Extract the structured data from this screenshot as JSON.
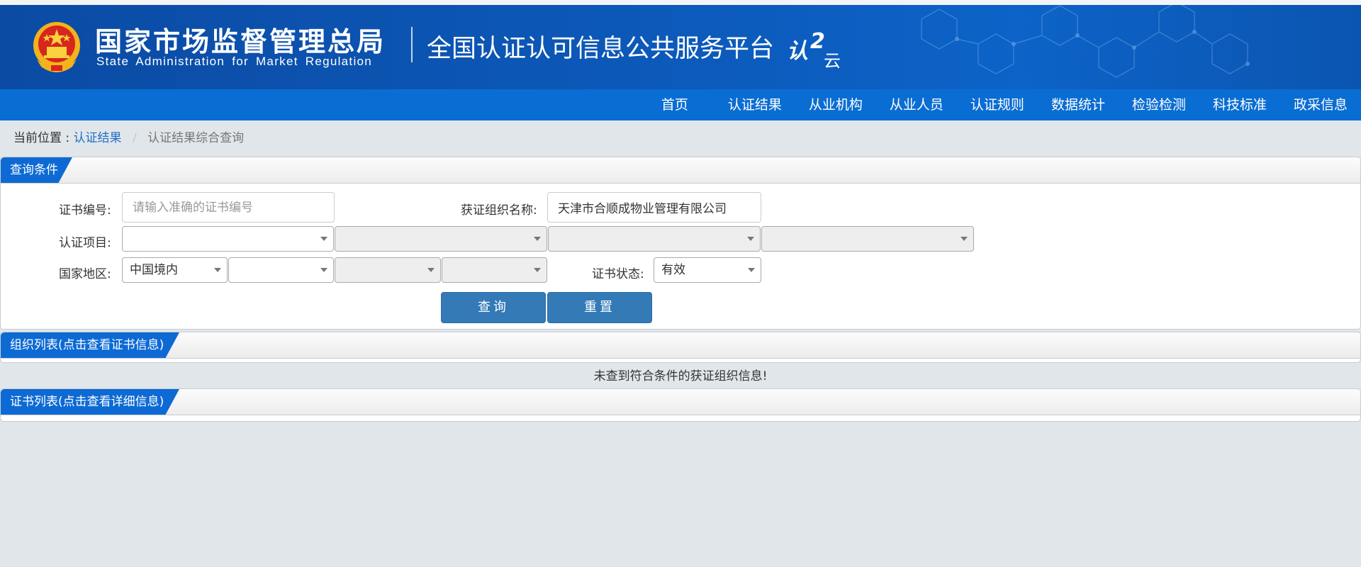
{
  "header": {
    "brand_cn": "国家市场监督管理总局",
    "brand_en": "State Administration for Market Regulation",
    "platform_title": "全国认证认可信息公共服务平台",
    "logo_text_main": "认",
    "logo_text_num": "2",
    "logo_text_sub": "云",
    "colors": {
      "header_bg": "#0c58b8",
      "nav_bg": "#0a6dd3",
      "accent": "#337ab7"
    }
  },
  "nav": {
    "items": [
      {
        "label": "首页"
      },
      {
        "label": "认证结果"
      },
      {
        "label": "从业机构"
      },
      {
        "label": "从业人员"
      },
      {
        "label": "认证规则"
      },
      {
        "label": "数据统计"
      },
      {
        "label": "检验检测"
      },
      {
        "label": "科技标准"
      },
      {
        "label": "政采信息"
      }
    ]
  },
  "breadcrumb": {
    "prefix": "当前位置 :",
    "parent": "认证结果",
    "separator": "/",
    "current": "认证结果综合查询"
  },
  "query_panel": {
    "title": "查询条件",
    "cert_no_label": "证书编号:",
    "cert_no_placeholder": "请输入准确的证书编号",
    "cert_no_value": "",
    "org_name_label": "获证组织名称:",
    "org_name_value": "天津市合顺成物业管理有限公司",
    "cert_item_label": "认证项目:",
    "cert_item_selects": [
      "",
      "",
      "",
      ""
    ],
    "region_label": "国家地区:",
    "region_selects": [
      "中国境内",
      "",
      "",
      ""
    ],
    "status_label": "证书状态:",
    "status_value": "有效",
    "query_button": "查询",
    "reset_button": "重置"
  },
  "org_panel": {
    "title": "组织列表(点击查看证书信息)",
    "empty_message": "未查到符合条件的获证组织信息!"
  },
  "cert_panel": {
    "title": "证书列表(点击查看详细信息)"
  }
}
